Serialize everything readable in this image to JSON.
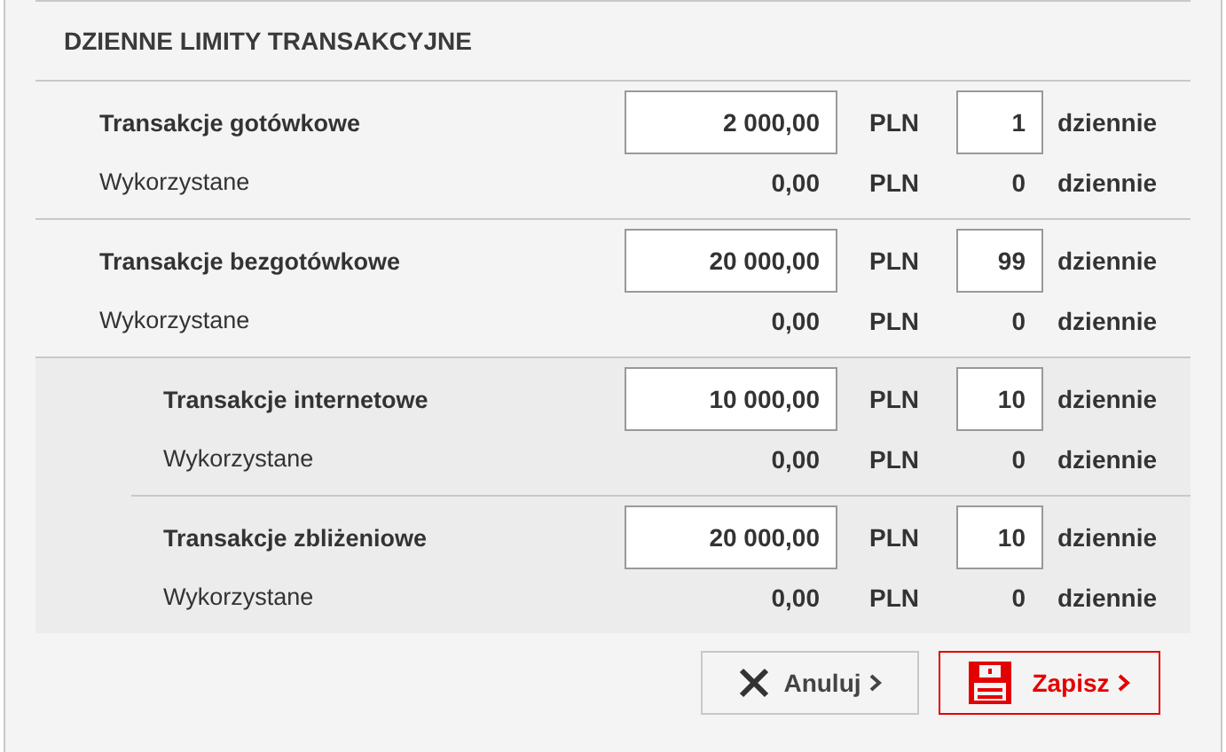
{
  "title": "DZIENNE LIMITY TRANSAKCYJNE",
  "limits": [
    {
      "name": "Transakcje gotówkowe",
      "amount": "2 000,00",
      "currency": "PLN",
      "count": "1",
      "period": "dziennie",
      "used_label": "Wykorzystane",
      "used_amount": "0,00",
      "used_currency": "PLN",
      "used_count": "0",
      "used_period": "dziennie"
    },
    {
      "name": "Transakcje bezgotówkowe",
      "amount": "20 000,00",
      "currency": "PLN",
      "count": "99",
      "period": "dziennie",
      "used_label": "Wykorzystane",
      "used_amount": "0,00",
      "used_currency": "PLN",
      "used_count": "0",
      "used_period": "dziennie",
      "children": [
        {
          "name": "Transakcje internetowe",
          "amount": "10 000,00",
          "currency": "PLN",
          "count": "10",
          "period": "dziennie",
          "used_label": "Wykorzystane",
          "used_amount": "0,00",
          "used_currency": "PLN",
          "used_count": "0",
          "used_period": "dziennie"
        },
        {
          "name": "Transakcje zbliżeniowe",
          "amount": "20 000,00",
          "currency": "PLN",
          "count": "10",
          "period": "dziennie",
          "used_label": "Wykorzystane",
          "used_amount": "0,00",
          "used_currency": "PLN",
          "used_count": "0",
          "used_period": "dziennie"
        }
      ]
    }
  ],
  "buttons": [
    {
      "label": "Anuluj",
      "kind": "cancel"
    },
    {
      "label": "Zapisz",
      "kind": "save"
    }
  ]
}
